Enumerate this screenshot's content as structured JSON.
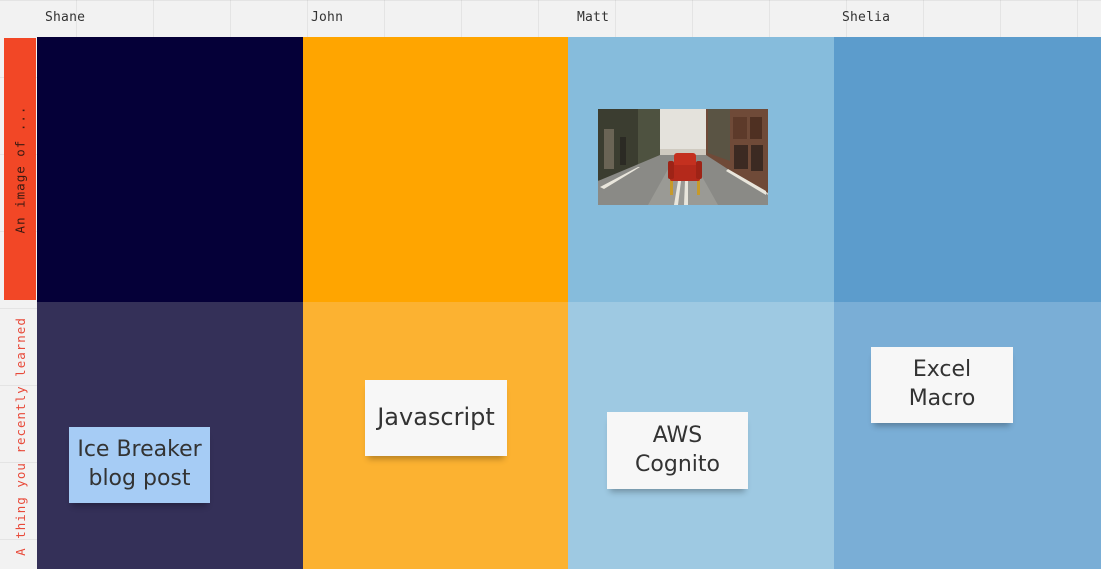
{
  "columns": {
    "shane": "Shane",
    "john": "John",
    "matt": "Matt",
    "shelia": "Shelia"
  },
  "rows": {
    "image": "An image of ...",
    "learned": "A thing you recently learned"
  },
  "stickies": {
    "shane": "Ice Breaker blog post",
    "john": "Javascript",
    "matt": "AWS Cognito",
    "shelia": "Excel Macro"
  },
  "colors": {
    "row_header_accent": "#f24726",
    "shane_row1": "#050038",
    "shane_row2": "#343058",
    "john_row1": "#ffa500",
    "john_row2": "#fcb231",
    "matt_row1": "#86bcdc",
    "matt_row2": "#9ec9e2",
    "shelia_row1": "#5c9ccc",
    "shelia_row2": "#7aaed6",
    "sticky_blue": "#a6ccf5",
    "sticky_white": "#f7f7f7"
  }
}
